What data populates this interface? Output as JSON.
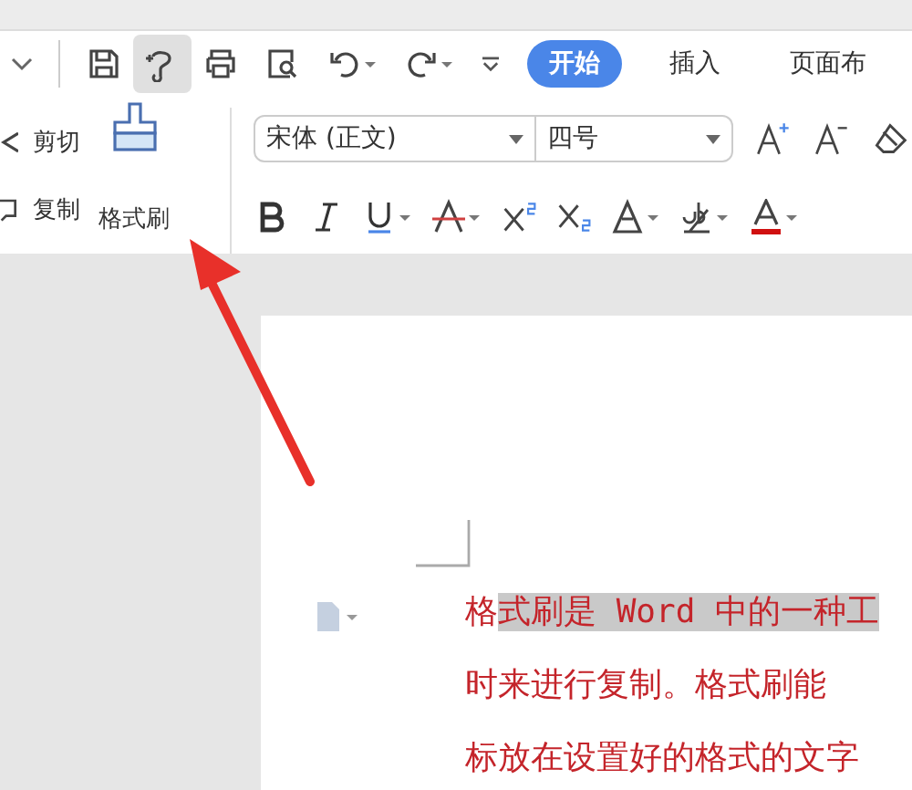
{
  "ribbon_tabs": [
    {
      "label": "开始",
      "selected": true
    },
    {
      "label": "插入",
      "selected": false
    },
    {
      "label": "页面布",
      "selected": false
    }
  ],
  "clipboard": {
    "cut": "剪切",
    "copy": "复制",
    "format_painter": "格式刷"
  },
  "font": {
    "family": "宋体 (正文)",
    "size": "四号"
  },
  "document": {
    "lines": [
      {
        "segments": [
          {
            "text": "格",
            "highlighted": false
          },
          {
            "text": "式刷是 Word 中的一种工",
            "highlighted": true
          }
        ]
      },
      {
        "segments": [
          {
            "text": "时来进行复制。格式刷能",
            "highlighted": false
          }
        ]
      },
      {
        "segments": [
          {
            "text": "标放在设置好的格式的文字",
            "highlighted": false
          }
        ]
      }
    ]
  }
}
